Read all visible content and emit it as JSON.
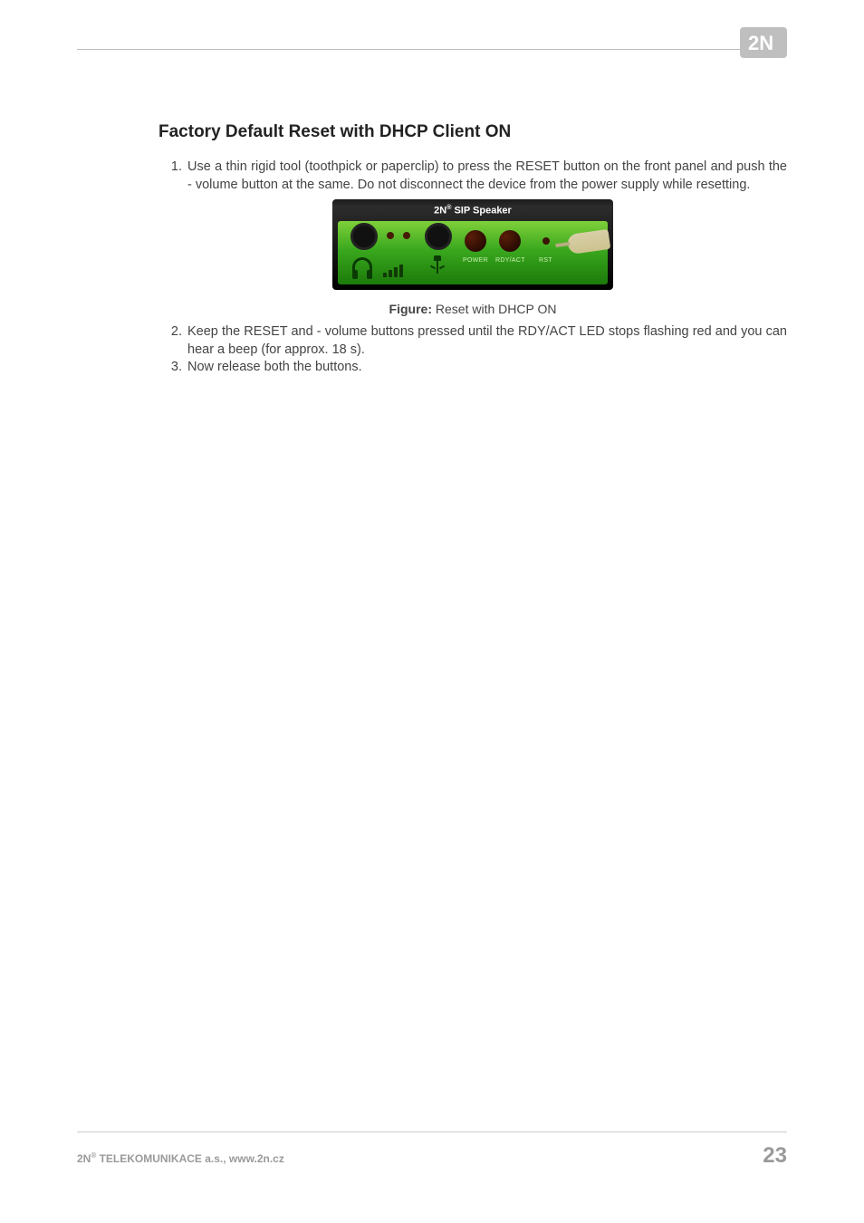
{
  "logo": {
    "text": "2N"
  },
  "heading": "Factory Default Reset with DHCP Client ON",
  "steps": [
    "Use a thin rigid tool (toothpick or paperclip) to press the RESET button on the front panel and push the - volume button at the same. Do not disconnect the device from the power supply while resetting.",
    "Keep the RESET and - volume buttons pressed until the RDY/ACT LED stops flashing red and you can hear a beep (for approx. 18 s).",
    "Now release both the buttons."
  ],
  "device": {
    "title_prefix": "2N",
    "title_suffix": "SIP Speaker",
    "led_labels": [
      "POWER",
      "RDY/ACT",
      "RST"
    ]
  },
  "figure": {
    "label": "Figure:",
    "caption": " Reset with DHCP ON"
  },
  "footer": {
    "company_prefix": "2N",
    "company_suffix": " TELEKOMUNIKACE a.s., www.2n.cz",
    "page_number": "23"
  }
}
